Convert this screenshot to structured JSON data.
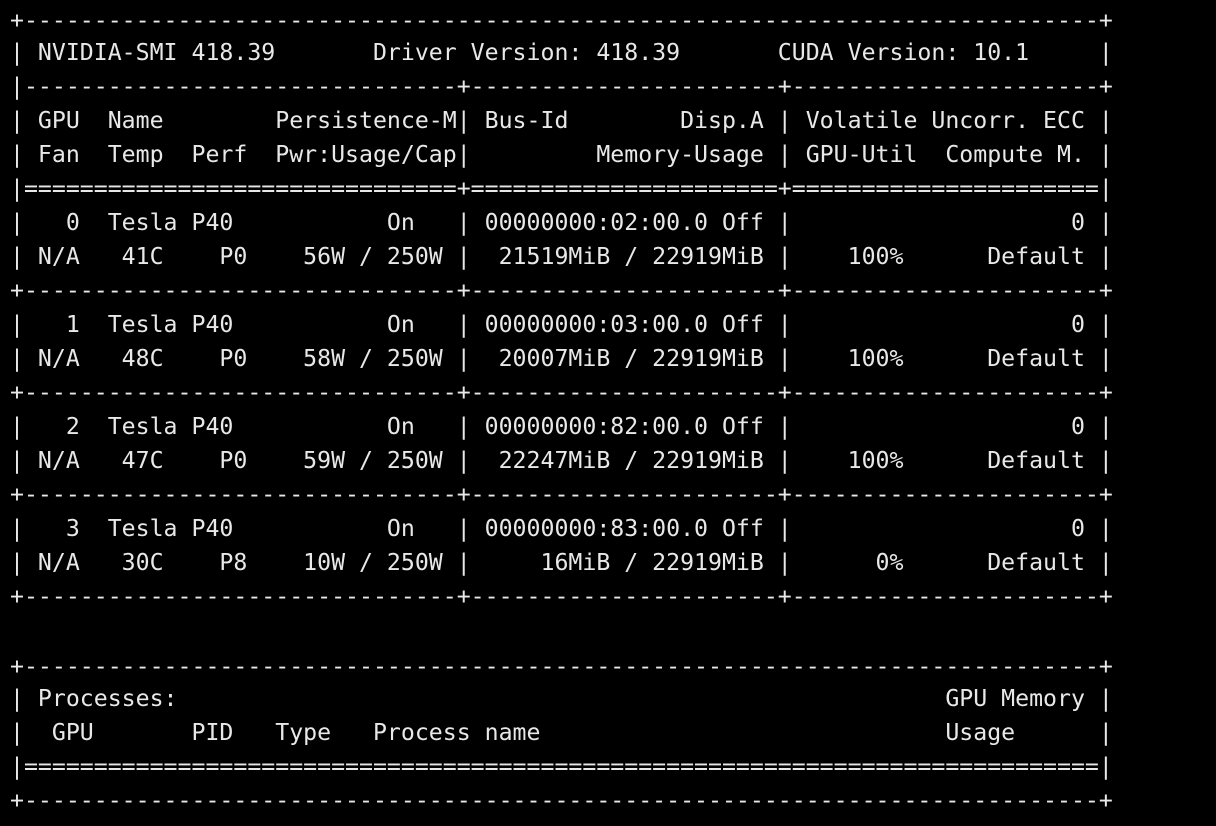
{
  "terminal": {
    "lines": [
      "+-----------------------------------------------------------------------------+",
      "| NVIDIA-SMI 418.39       Driver Version: 418.39       CUDA Version: 10.1     |",
      "|-------------------------------+----------------------+----------------------+",
      "| GPU  Name        Persistence-M| Bus-Id        Disp.A | Volatile Uncorr. ECC |",
      "| Fan  Temp  Perf  Pwr:Usage/Cap|         Memory-Usage | GPU-Util  Compute M. |",
      "|===============================+======================+======================|",
      "|   0  Tesla P40           On   | 00000000:02:00.0 Off |                    0 |",
      "| N/A   41C    P0    56W / 250W |  21519MiB / 22919MiB |    100%      Default |",
      "+-------------------------------+----------------------+----------------------+",
      "|   1  Tesla P40           On   | 00000000:03:00.0 Off |                    0 |",
      "| N/A   48C    P0    58W / 250W |  20007MiB / 22919MiB |    100%      Default |",
      "+-------------------------------+----------------------+----------------------+",
      "|   2  Tesla P40           On   | 00000000:82:00.0 Off |                    0 |",
      "| N/A   47C    P0    59W / 250W |  22247MiB / 22919MiB |    100%      Default |",
      "+-------------------------------+----------------------+----------------------+",
      "|   3  Tesla P40           On   | 00000000:83:00.0 Off |                    0 |",
      "| N/A   30C    P8    10W / 250W |     16MiB / 22919MiB |      0%      Default |",
      "+-------------------------------+----------------------+----------------------+",
      "",
      "",
      "+-----------------------------------------------------------------------------+",
      "| Processes:                                                       GPU Memory |",
      "|  GPU       PID   Type   Process name                             Usage      |",
      "|=============================================================================|",
      "+-----------------------------------------------------------------------------+"
    ]
  }
}
